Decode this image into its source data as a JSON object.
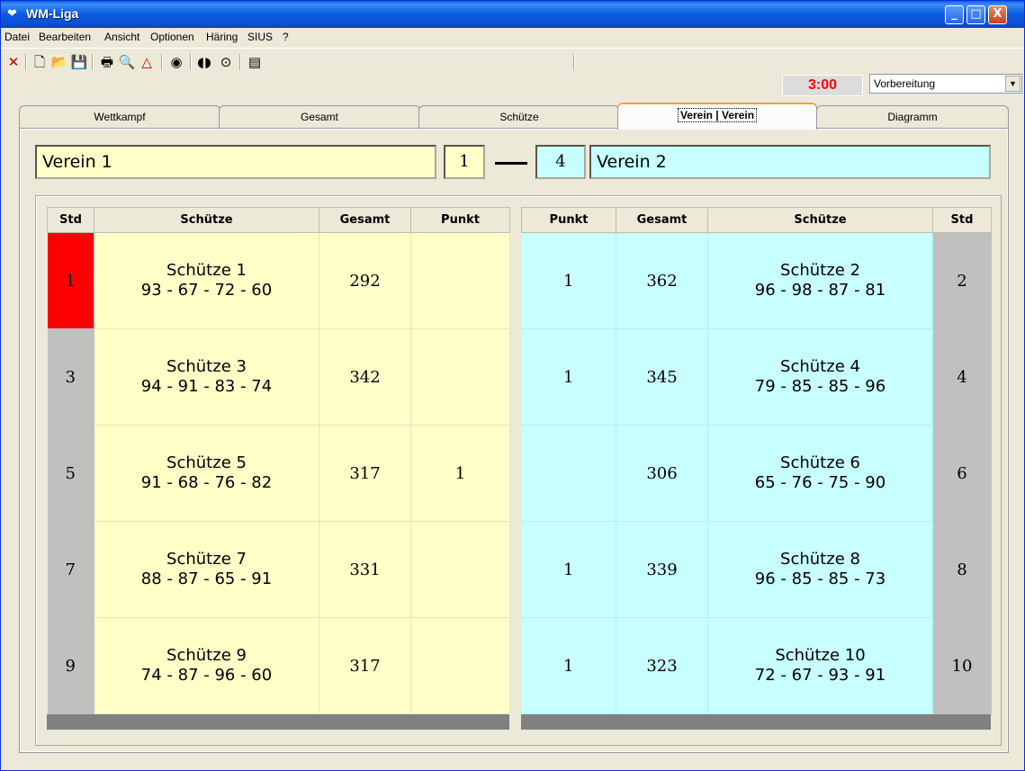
{
  "window": {
    "title": "WM-Liga",
    "min": "_",
    "max": "□",
    "close": "X"
  },
  "menu": [
    "Datei",
    "Bearbeiten",
    "Ansicht",
    "Optionen",
    "Häring",
    "SIUS",
    "?"
  ],
  "toolbar": {
    "timer": "3:00",
    "mode_select": "Vorbereitung",
    "icons": [
      "close-icon",
      "new-icon",
      "open-icon",
      "save-icon",
      "print-icon",
      "preview-icon",
      "print-setup-icon",
      "target-icon",
      "split-icon",
      "record-icon",
      "device-icon"
    ]
  },
  "tabs": [
    "Wettkampf",
    "Gesamt",
    "Schütze",
    "Verein | Verein",
    "Diagramm"
  ],
  "active_tab": "Verein | Verein",
  "match": {
    "team_left": "Verein 1",
    "score_left": "1",
    "score_right": "4",
    "team_right": "Verein 2"
  },
  "left_table": {
    "headers": [
      "Std",
      "Schütze",
      "Gesamt",
      "Punkt"
    ],
    "rows": [
      {
        "std": "1",
        "name": "Schütze  1",
        "series": "93 - 67 - 72 - 60",
        "total": "292",
        "punkt": ""
      },
      {
        "std": "3",
        "name": "Schütze  3",
        "series": "94 - 91 - 83 - 74",
        "total": "342",
        "punkt": ""
      },
      {
        "std": "5",
        "name": "Schütze 5",
        "series": "91 - 68 - 76 - 82",
        "total": "317",
        "punkt": "1"
      },
      {
        "std": "7",
        "name": "Schütze 7",
        "series": "88 - 87 - 65 - 91",
        "total": "331",
        "punkt": ""
      },
      {
        "std": "9",
        "name": "Schütze 9",
        "series": "74 - 87 - 96 - 60",
        "total": "317",
        "punkt": ""
      }
    ]
  },
  "right_table": {
    "headers": [
      "Punkt",
      "Gesamt",
      "Schütze",
      "Std"
    ],
    "rows": [
      {
        "punkt": "1",
        "total": "362",
        "name": "Schütze 2",
        "series": "96 - 98 - 87 - 81",
        "std": "2"
      },
      {
        "punkt": "1",
        "total": "345",
        "name": "Schütze 4",
        "series": "79 - 85 - 85 - 96",
        "std": "4"
      },
      {
        "punkt": "",
        "total": "306",
        "name": "Schütze 6",
        "series": "65 - 76 - 75 - 90",
        "std": "6"
      },
      {
        "punkt": "1",
        "total": "339",
        "name": "Schütze 8",
        "series": "96 - 85 - 85 - 73",
        "std": "8"
      },
      {
        "punkt": "1",
        "total": "323",
        "name": "Schütze 10",
        "series": "72 - 67 - 93 - 91",
        "std": "10"
      }
    ]
  },
  "colors": {
    "left_bg": "#ffffc8",
    "right_bg": "#c8ffff",
    "highlight": "#ff0000",
    "timer": "#ff0000"
  }
}
